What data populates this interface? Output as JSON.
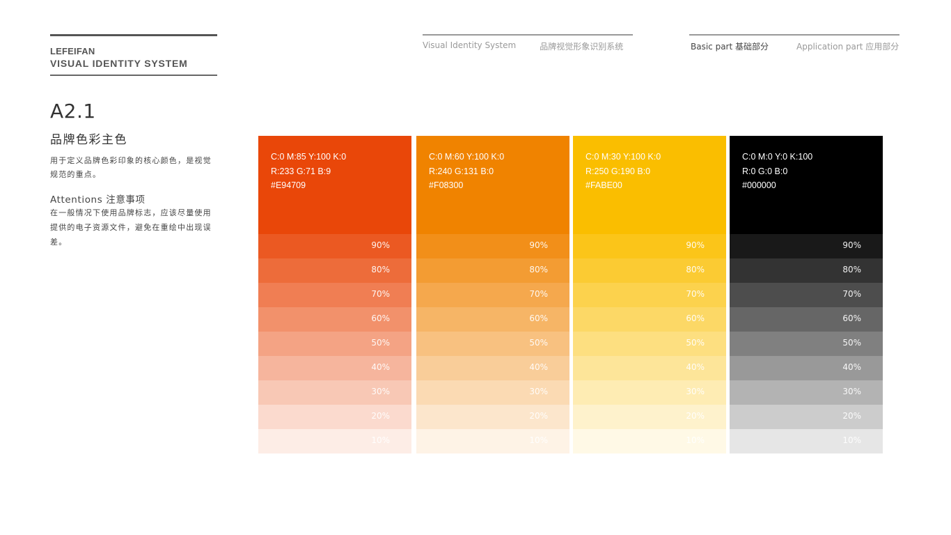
{
  "header": {
    "brand_name": "LEFEIFAN",
    "brand_system": "VISUAL IDENTITY SYSTEM",
    "nav_left": [
      "Visual Identity System",
      "品牌视觉形象识别系统"
    ],
    "nav_right": [
      {
        "label": "Basic part  基础部分",
        "active": true
      },
      {
        "label": "Application part  应用部分",
        "active": false
      }
    ]
  },
  "section": {
    "code": "A2.1",
    "title": "品牌色彩主色",
    "description": "用于定义品牌色彩印象的核心颜色，是视觉规范的重点。",
    "attentions_title": "Attentions 注意事项",
    "attentions_text": "在一般情况下使用品牌标志，应该尽量使用提供的电子资源文件，避免在重绘中出现误差。"
  },
  "palette": {
    "colors": [
      {
        "name": "brand-red-orange",
        "cmyk": "C:0 M:85 Y:100 K:0",
        "rgb": "R:233 G:71 B:9",
        "hex_label": "#E94709",
        "hex": "#E94709"
      },
      {
        "name": "brand-orange",
        "cmyk": "C:0 M:60 Y:100 K:0",
        "rgb": "R:240 G:131 B:0",
        "hex_label": "#F08300",
        "hex": "#F08300"
      },
      {
        "name": "brand-yellow",
        "cmyk": "C:0 M:30 Y:100 K:0",
        "rgb": "R:250 G:190 B:0",
        "hex_label": "#FABE00",
        "hex": "#FABE00"
      },
      {
        "name": "brand-black",
        "cmyk": "C:0 M:0 Y:0 K:100",
        "rgb": "R:0 G:0 B:0",
        "hex_label": "#000000",
        "hex": "#000000"
      }
    ],
    "tints": [
      {
        "label": "90%",
        "value": 0.9
      },
      {
        "label": "80%",
        "value": 0.8
      },
      {
        "label": "70%",
        "value": 0.7
      },
      {
        "label": "60%",
        "value": 0.6
      },
      {
        "label": "50%",
        "value": 0.5
      },
      {
        "label": "40%",
        "value": 0.4
      },
      {
        "label": "30%",
        "value": 0.3
      },
      {
        "label": "20%",
        "value": 0.2
      },
      {
        "label": "10%",
        "value": 0.1
      }
    ]
  }
}
